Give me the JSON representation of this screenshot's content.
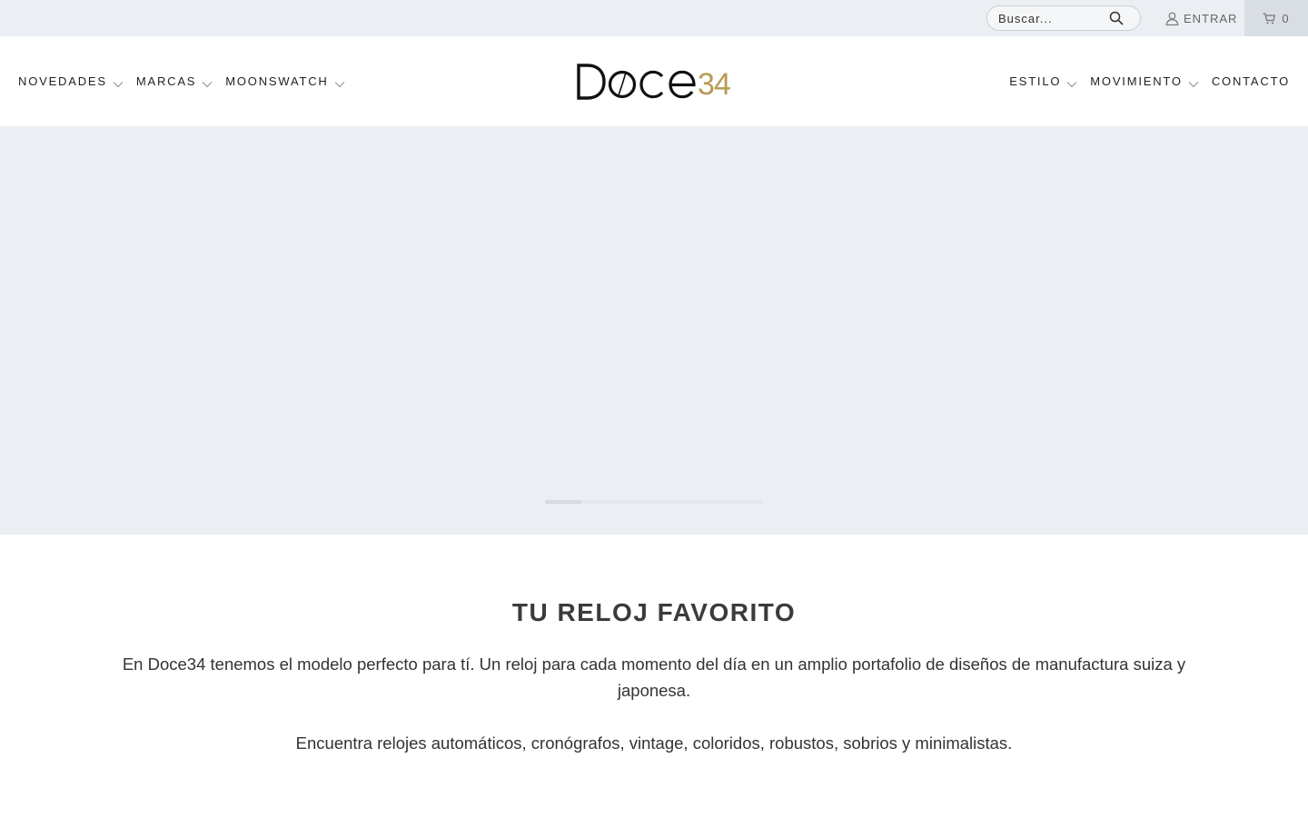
{
  "topbar": {
    "search": {
      "placeholder": "Buscar..."
    },
    "login_label": "ENTRAR",
    "cart_count": "0"
  },
  "nav": {
    "left": [
      {
        "label": "NOVEDADES",
        "has_dropdown": true
      },
      {
        "label": "MARCAS",
        "has_dropdown": true
      },
      {
        "label": "MOONSWATCH",
        "has_dropdown": true
      }
    ],
    "right": [
      {
        "label": "ESTILO",
        "has_dropdown": true
      },
      {
        "label": "MOVIMIENTO",
        "has_dropdown": true
      },
      {
        "label": "CONTACTO",
        "has_dropdown": false
      }
    ]
  },
  "logo": {
    "text_main": "Doce",
    "text_accent": "34",
    "accent_color": "#b89b54"
  },
  "hero": {
    "slide_progress": 0.166
  },
  "intro": {
    "title": "TU RELOJ FAVORITO",
    "paragraph1": "En Doce34 tenemos el modelo perfecto para tí. Un reloj para cada momento del día en un amplio portafolio de diseños de manufactura suiza y japonesa.",
    "paragraph2": "Encuentra relojes automáticos, cronógrafos, vintage, coloridos, robustos, sobrios y minimalistas."
  },
  "colors": {
    "topbar_bg": "#ebeef2",
    "hero_bg": "#ebeef2",
    "brand_gold": "#b89b54"
  }
}
